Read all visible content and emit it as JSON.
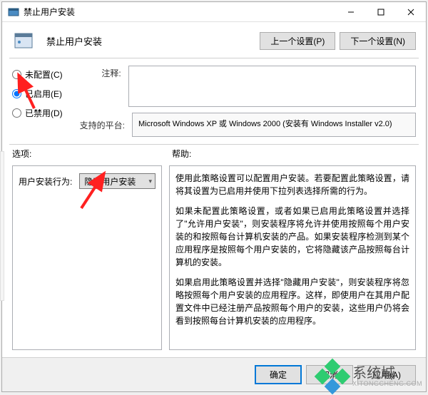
{
  "window": {
    "title": "禁止用户安装",
    "header_title": "禁止用户安装"
  },
  "nav": {
    "prev": "上一个设置(P)",
    "next": "下一个设置(N)"
  },
  "radios": {
    "not_configured": "未配置(C)",
    "enabled": "已启用(E)",
    "disabled": "已禁用(D)",
    "selected": "enabled"
  },
  "comment": {
    "label": "注释:",
    "value": ""
  },
  "platform": {
    "label": "支持的平台:",
    "value": "Microsoft Windows XP 或 Windows 2000 (安装有 Windows Installer v2.0)"
  },
  "sections": {
    "options": "选项:",
    "help": "帮助:"
  },
  "option": {
    "label": "用户安装行为:",
    "select_value": "隐藏用户安装"
  },
  "help_paragraphs": [
    "使用此策略设置可以配置用户安装。若要配置此策略设置，请将其设置为已启用并使用下拉列表选择所需的行为。",
    "如果未配置此策略设置，或者如果已启用此策略设置并选择了\"允许用户安装\"，则安装程序将允许并使用按照每个用户安装的和按照每台计算机安装的产品。如果安装程序检测到某个应用程序是按照每个用户安装的，它将隐藏该产品按照每台计算机的安装。",
    "如果启用此策略设置并选择\"隐藏用户安装\"，则安装程序将忽略按照每个用户安装的应用程序。这样，即使用户在其用户配置文件中已经注册产品按照每个用户的安装，这些用户仍将会看到按照每台计算机安装的应用程序。"
  ],
  "footer": {
    "ok": "确定",
    "cancel": "取消",
    "apply": "应用(A)"
  },
  "watermark": {
    "cn": "系统城",
    "en": "XITONGCHENG.COM"
  }
}
